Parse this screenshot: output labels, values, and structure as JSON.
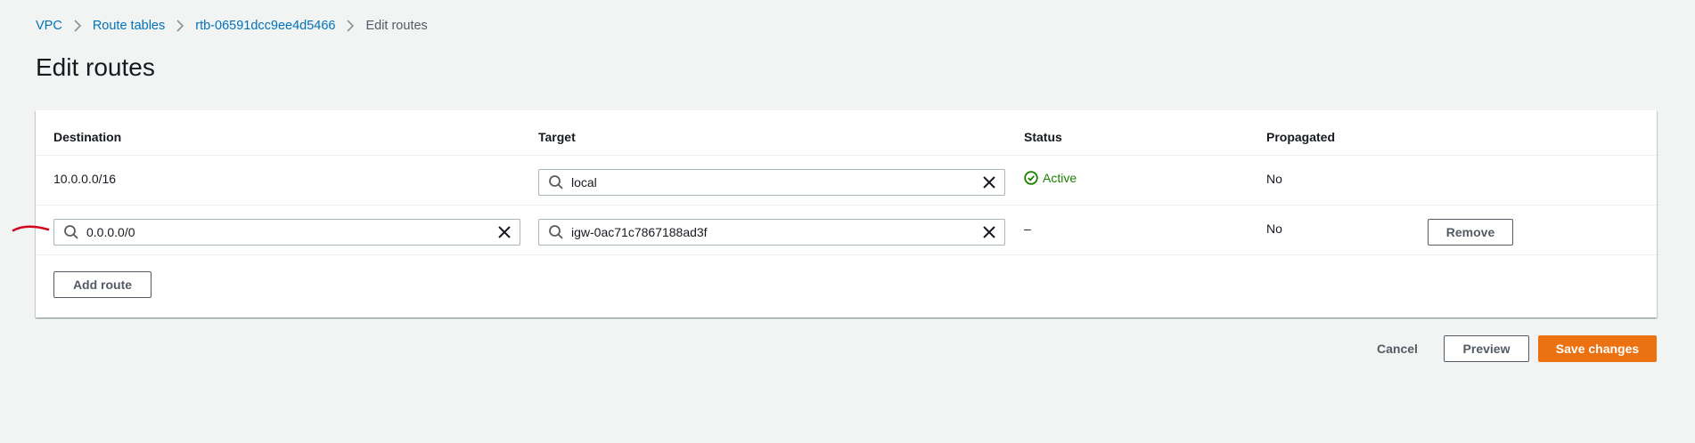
{
  "breadcrumb": {
    "items": [
      "VPC",
      "Route tables",
      "rtb-06591dcc9ee4d5466"
    ],
    "current": "Edit routes"
  },
  "page": {
    "title": "Edit routes"
  },
  "table": {
    "headers": {
      "destination": "Destination",
      "target": "Target",
      "status": "Status",
      "propagated": "Propagated"
    },
    "rows": [
      {
        "destination": "10.0.0.0/16",
        "target": "local",
        "status": "Active",
        "propagated": "No"
      },
      {
        "destination": "0.0.0.0/0",
        "target": "igw-0ac71c7867188ad3f",
        "status": "–",
        "propagated": "No",
        "action": "Remove"
      }
    ],
    "add_route_label": "Add route"
  },
  "footer": {
    "cancel": "Cancel",
    "preview": "Preview",
    "save": "Save changes"
  },
  "colors": {
    "accent": "#ec7211",
    "link": "#0073bb",
    "success": "#1d8102",
    "annotation": "#d0021b"
  }
}
